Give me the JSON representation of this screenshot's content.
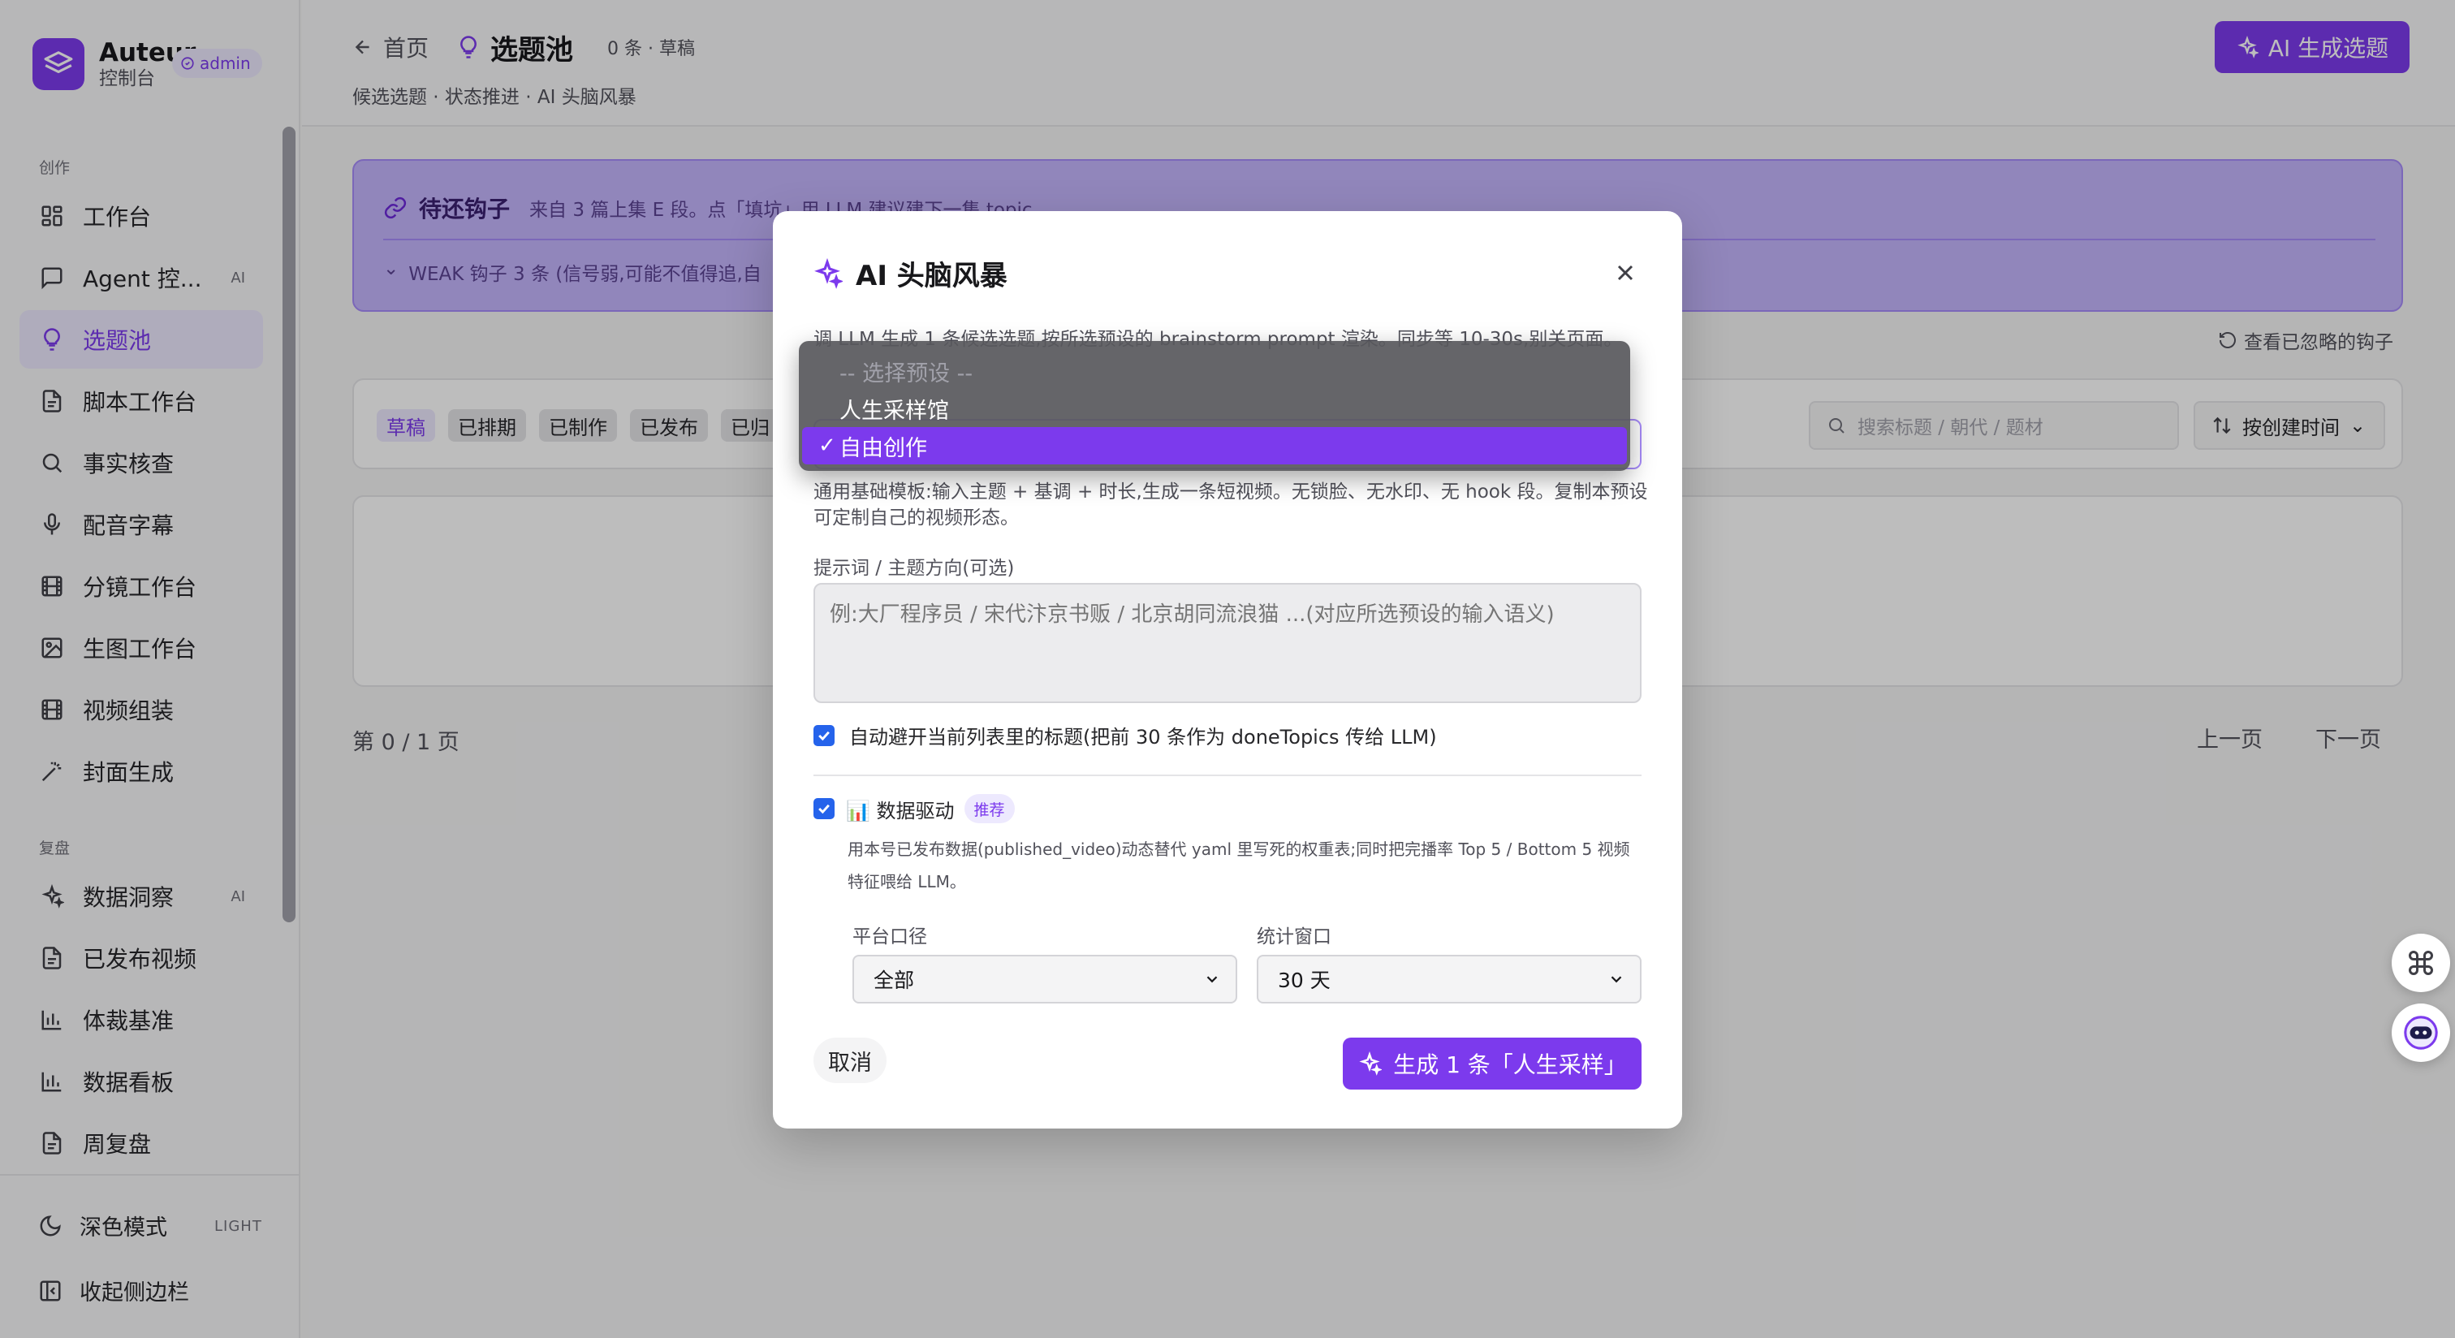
{
  "sidebar": {
    "brand_name": "Auteur",
    "brand_sub": "控制台",
    "badge": "admin",
    "section_create": "创作",
    "section_review": "复盘",
    "items": [
      {
        "label": "工作台",
        "tag": ""
      },
      {
        "label": "Agent 控...",
        "tag": "AI"
      },
      {
        "label": "选题池",
        "tag": ""
      },
      {
        "label": "脚本工作台",
        "tag": ""
      },
      {
        "label": "事实核查",
        "tag": ""
      },
      {
        "label": "配音字幕",
        "tag": ""
      },
      {
        "label": "分镜工作台",
        "tag": ""
      },
      {
        "label": "生图工作台",
        "tag": ""
      },
      {
        "label": "视频组装",
        "tag": ""
      },
      {
        "label": "封面生成",
        "tag": ""
      },
      {
        "label": "数据洞察",
        "tag": "AI"
      },
      {
        "label": "已发布视频",
        "tag": ""
      },
      {
        "label": "体裁基准",
        "tag": ""
      },
      {
        "label": "数据看板",
        "tag": ""
      },
      {
        "label": "周复盘",
        "tag": ""
      }
    ],
    "dark_mode": "深色模式",
    "dark_mode_tag": "LIGHT",
    "collapse": "收起侧边栏"
  },
  "header": {
    "back": "首页",
    "title": "选题池",
    "count": "0 条 · 草稿",
    "subtitle": "候选选题 · 状态推进 · AI 头脑风暴",
    "generate_button": "AI 生成选题"
  },
  "hooks": {
    "title": "待还钩子",
    "desc": "来自 3 篇上集 E 段。点「填坑」用 LLM 建议建下一集 topic",
    "weak": "WEAK 钩子 3 条 (信号弱,可能不值得追,自",
    "ignored_link": "查看已忽略的钩子"
  },
  "filters": {
    "chips": [
      "草稿",
      "已排期",
      "已制作",
      "已发布",
      "已归"
    ],
    "search_placeholder": "搜索标题 / 朝代 / 题材",
    "sort": "按创建时间"
  },
  "pagination": {
    "info": "第 0 / 1 页",
    "prev": "上一页",
    "next": "下一页"
  },
  "modal": {
    "title": "AI 头脑风暴",
    "desc": "调 LLM 生成 1 条候选选题,按所选预设的 brainstorm prompt 渲染。同步等 10-30s,别关页面。",
    "preset_desc": "通用基础模板:输入主题 + 基调 + 时长,生成一条短视频。无锁脸、无水印、无 hook 段。复制本预设可定制自己的视频形态。",
    "prompt_label": "提示词 / 主题方向(可选)",
    "prompt_placeholder": "例:大厂程序员 / 宋代汴京书贩 / 北京胡同流浪猫 ...(对应所选预设的输入语义)",
    "avoid_label": "自动避开当前列表里的标题(把前 30 条作为 doneTopics 传给 LLM)",
    "data_driven_label": "📊 数据驱动",
    "recommend_badge": "推荐",
    "data_desc": "用本号已发布数据(published_video)动态替代 yaml 里写死的权重表;同时把完播率 Top 5 / Bottom 5 视频特征喂给 LLM。",
    "platform_label": "平台口径",
    "platform_value": "全部",
    "window_label": "统计窗口",
    "window_value": "30 天",
    "cancel": "取消",
    "submit": "生成 1 条「人生采样」"
  },
  "dropdown": {
    "options": [
      {
        "label": "-- 选择预设 --",
        "state": "disabled"
      },
      {
        "label": "人生采样馆",
        "state": "normal"
      },
      {
        "label": "自由创作",
        "state": "selected"
      }
    ],
    "check": "✓"
  },
  "colors": {
    "accent": "#7c3aed",
    "accent_soft": "#ede9fe",
    "checkbox": "#2563eb"
  }
}
